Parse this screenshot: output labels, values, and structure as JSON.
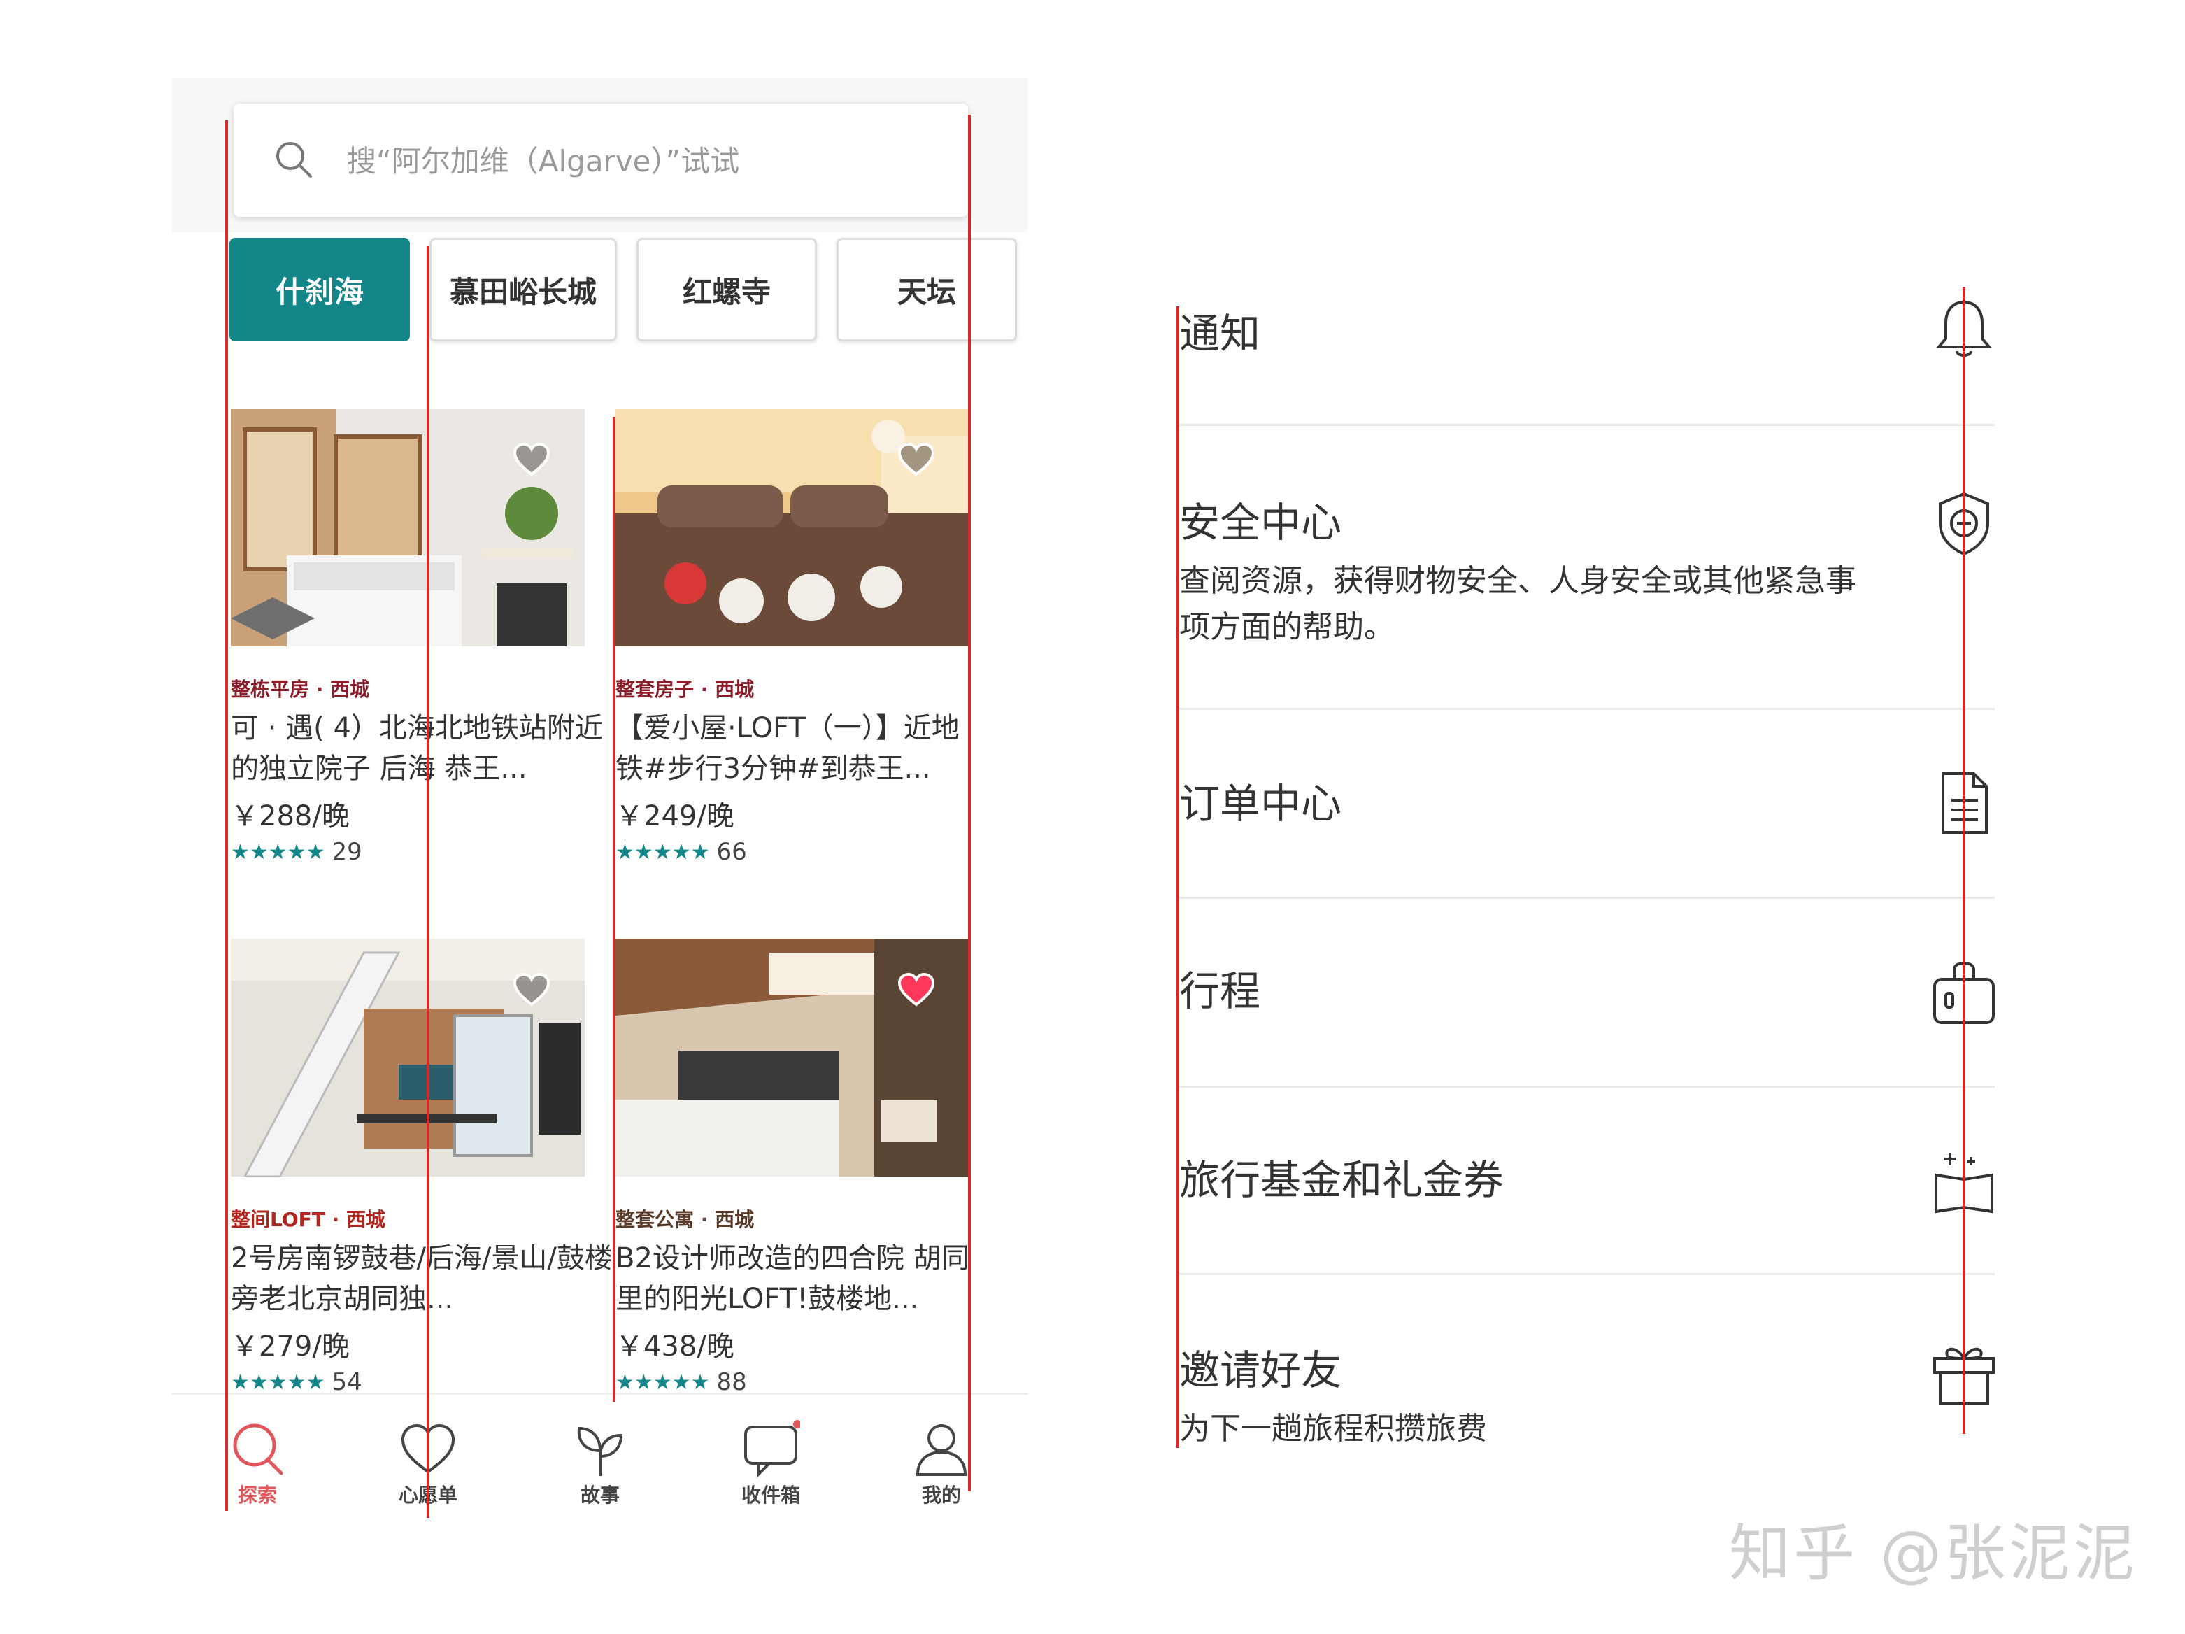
{
  "search": {
    "placeholder": "搜“阿尔加维（Algarve）”试试"
  },
  "chips": [
    "什刹海",
    "慕田峪长城",
    "红螺寺",
    "天坛"
  ],
  "listings": [
    {
      "type": "整栋平房 · 西城",
      "title": "可 · 遇( 4）北海北地铁站附近的独立院子 后海 恭王...",
      "price": "￥288/晚",
      "stars": "★★★★★",
      "reviews": "29",
      "favorited": false,
      "type_color": "#8b1e2a"
    },
    {
      "type": "整套房子 · 西城",
      "title": "【爱小屋·LOFT（一）】近地铁#步行3分钟#到恭王...",
      "price": "￥249/晚",
      "stars": "★★★★★",
      "reviews": "66",
      "favorited": false,
      "type_color": "#8b1e2a"
    },
    {
      "type": "整间LOFT · 西城",
      "title": "2号房南锣鼓巷/后海/景山/鼓楼旁老北京胡同独...",
      "price": "￥279/晚",
      "stars": "★★★★★",
      "reviews": "54",
      "favorited": false,
      "type_color": "#b3261e"
    },
    {
      "type": "整套公寓 · 西城",
      "title": "B2设计师改造的四合院 胡同里的阳光LOFT!鼓楼地...",
      "price": "￥438/晚",
      "stars": "★★★★★",
      "reviews": "88",
      "favorited": true,
      "type_color": "#5a3b2a"
    }
  ],
  "tabs": [
    "探索",
    "心愿单",
    "故事",
    "收件箱",
    "我的"
  ],
  "menu": [
    {
      "title": "通知",
      "desc": "",
      "icon": "bell-icon"
    },
    {
      "title": "安全中心",
      "desc": "查阅资源，获得财物安全、人身安全或其他紧急事项方面的帮助。",
      "icon": "shield-icon"
    },
    {
      "title": "订单中心",
      "desc": "",
      "icon": "document-icon"
    },
    {
      "title": "行程",
      "desc": "",
      "icon": "suitcase-icon"
    },
    {
      "title": "旅行基金和礼金券",
      "desc": "",
      "icon": "wallet-sparkle-icon"
    },
    {
      "title": "邀请好友",
      "desc": "为下一趟旅程积攒旅费",
      "icon": "gift-icon"
    }
  ],
  "watermark": "知乎 @张泥泥",
  "colors": {
    "accent": "#128689",
    "active_tab": "#e0565b",
    "guide": "#d42a2a",
    "heart_active": "#ff385c"
  }
}
